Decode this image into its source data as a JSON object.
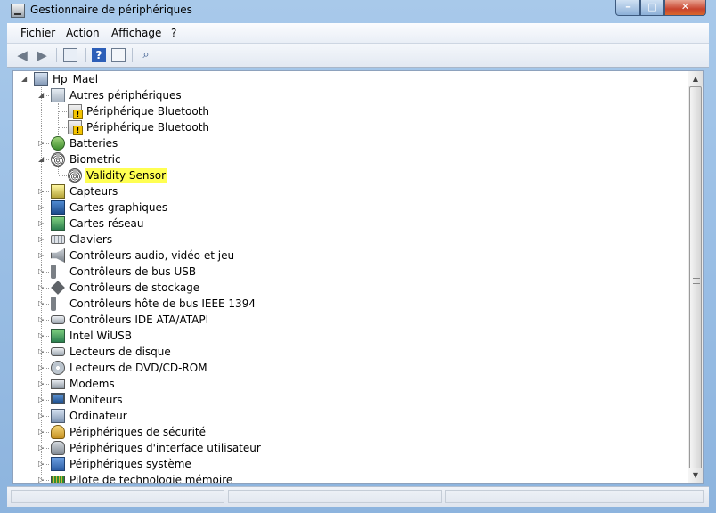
{
  "window": {
    "title": "Gestionnaire de périphériques",
    "controls": {
      "minimize": "–",
      "maximize": "□",
      "close": "✕"
    }
  },
  "menu": [
    "Fichier",
    "Action",
    "Affichage",
    "?"
  ],
  "toolbar": {
    "back_icon": "arrow-left-icon",
    "forward_icon": "arrow-right-icon",
    "console_icon": "console-tree-icon",
    "help_icon": "help-icon",
    "properties_icon": "properties-icon",
    "scan_icon": "scan-hardware-icon"
  },
  "tree": {
    "root": "Hp_Mael",
    "items": [
      {
        "label": "Autres périphériques",
        "expanded": true,
        "icon": "other-devices-icon"
      },
      {
        "label": "Périphérique Bluetooth",
        "child": true,
        "icon": "warning-device-icon"
      },
      {
        "label": "Périphérique Bluetooth",
        "child": true,
        "icon": "warning-device-icon"
      },
      {
        "label": "Batteries",
        "icon": "battery-icon"
      },
      {
        "label": "Biometric",
        "expanded": true,
        "icon": "fingerprint-icon"
      },
      {
        "label": "Validity Sensor",
        "child": true,
        "selected": true,
        "icon": "fingerprint-sensor-icon"
      },
      {
        "label": "Capteurs",
        "icon": "sensor-icon"
      },
      {
        "label": "Cartes graphiques",
        "icon": "display-adapter-icon"
      },
      {
        "label": "Cartes réseau",
        "icon": "network-adapter-icon"
      },
      {
        "label": "Claviers",
        "icon": "keyboard-icon"
      },
      {
        "label": "Contrôleurs audio, vidéo et jeu",
        "icon": "speaker-icon"
      },
      {
        "label": "Contrôleurs de bus USB",
        "icon": "usb-icon"
      },
      {
        "label": "Contrôleurs de stockage",
        "icon": "storage-controller-icon"
      },
      {
        "label": "Contrôleurs hôte de bus IEEE 1394",
        "icon": "ieee1394-icon"
      },
      {
        "label": "Contrôleurs IDE ATA/ATAPI",
        "icon": "ide-controller-icon"
      },
      {
        "label": "Intel WiUSB",
        "icon": "wiusb-icon"
      },
      {
        "label": "Lecteurs de disque",
        "icon": "disk-drive-icon"
      },
      {
        "label": "Lecteurs de DVD/CD-ROM",
        "icon": "dvd-icon"
      },
      {
        "label": "Modems",
        "icon": "modem-icon"
      },
      {
        "label": "Moniteurs",
        "icon": "monitor-icon"
      },
      {
        "label": "Ordinateur",
        "icon": "computer-icon"
      },
      {
        "label": "Périphériques de sécurité",
        "icon": "security-device-icon"
      },
      {
        "label": "Périphériques d'interface utilisateur",
        "icon": "hid-icon"
      },
      {
        "label": "Périphériques système",
        "icon": "system-device-icon"
      },
      {
        "label": "Pilote de technologie mémoire",
        "icon": "memory-icon"
      }
    ]
  },
  "colors": {
    "selection_highlight": "#ffff52",
    "titlebar": "#a8c9ea",
    "close_button": "#c8442e"
  }
}
